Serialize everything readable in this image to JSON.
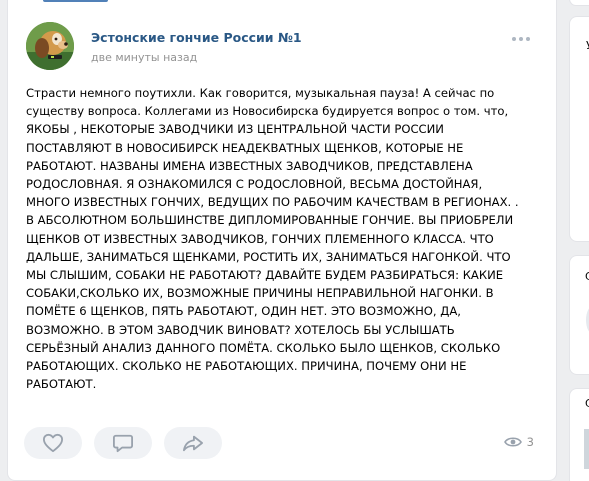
{
  "post": {
    "author": "Эстонские гончие России №1",
    "time": "две минуты назад",
    "text_lines": [
      "Страсти немного поутихли. Как говорится, музыкальная пауза! А сейчас по",
      "существу вопроса. Коллегами из Новосибирска будируется вопрос о том. что,",
      "ЯКОБЫ , НЕКОТОРЫЕ ЗАВОДЧИКИ ИЗ ЦЕНТРАЛЬНОЙ ЧАСТИ РОССИИ",
      "ПОСТАВЛЯЮТ В НОВОСИБИРСК НЕАДЕКВАТНЫХ ЩЕНКОВ, КОТОРЫЕ НЕ",
      "РАБОТАЮТ. НАЗВАНЫ ИМЕНА ИЗВЕСТНЫХ ЗАВОДЧИКОВ, ПРЕДСТАВЛЕНА",
      "РОДОСЛОВНАЯ. Я ОЗНАКОМИЛСЯ С РОДОСЛОВНОЙ, ВЕСЬМА ДОСТОЙНАЯ,",
      "МНОГО ИЗВЕСТНЫХ ГОНЧИХ, ВЕДУЩИХ ПО РАБОЧИМ КАЧЕСТВАМ В РЕГИОНАХ. .",
      "В АБСОЛЮТНОМ БОЛЬШИНСТВЕ ДИПЛОМИРОВАННЫЕ ГОНЧИЕ. ВЫ ПРИОБРЕЛИ",
      "ЩЕНКОВ ОТ ИЗВЕСТНЫХ ЗАВОДЧИКОВ, ГОНЧИХ ПЛЕМЕННОГО КЛАССА. ЧТО",
      "ДАЛЬШЕ, ЗАНИМАТЬСЯ ЩЕНКАМИ, РОСТИТЬ ИХ, ЗАНИМАТЬСЯ НАГОНКОЙ. ЧТО",
      "МЫ СЛЫШИМ, СОБАКИ НЕ РАБОТАЮТ? ДАВАЙТЕ БУДЕМ РАЗБИРАТЬСЯ: КАКИЕ",
      "СОБАКИ,СКОЛЬКО ИХ, ВОЗМОЖНЫЕ ПРИЧИНЫ НЕПРАВИЛЬНОЙ НАГОНКИ. В",
      "ПОМЁТЕ 6 ЩЕНКОВ, ПЯТЬ РАБОТАЮТ, ОДИН НЕТ. ЭТО ВОЗМОЖНО, ДА,",
      "ВОЗМОЖНО. В ЭТОМ ЗАВОДЧИК ВИНОВАТ? ХОТЕЛОСЬ БЫ УСЛЫШАТЬ",
      "СЕРЬЁЗНЫЙ АНАЛИЗ ДАННОГО ПОМЁТА. СКОЛЬКО БЫЛО ЩЕНКОВ, СКОЛЬКО",
      "РАБОТАЮЩИХ. СКОЛЬКО НЕ РАБОТАЮЩИХ. ПРИЧИНА, ПОЧЕМУ ОНИ НЕ",
      "РАБОТАЮТ."
    ],
    "views": "3"
  },
  "right_panel": {
    "card1_letter": "У",
    "card2_letter": "С",
    "card3_letter": "С"
  },
  "icons": {
    "like": "heart-icon",
    "comment": "comment-icon",
    "share": "share-icon",
    "views": "eye-icon",
    "more": "more-icon"
  },
  "colors": {
    "background": "#edeef0",
    "card": "#ffffff",
    "author": "#2a5885",
    "muted": "#939393",
    "action_icon": "#99a2ad",
    "action_bg": "#f0f2f5",
    "accent": "#5181b8"
  }
}
